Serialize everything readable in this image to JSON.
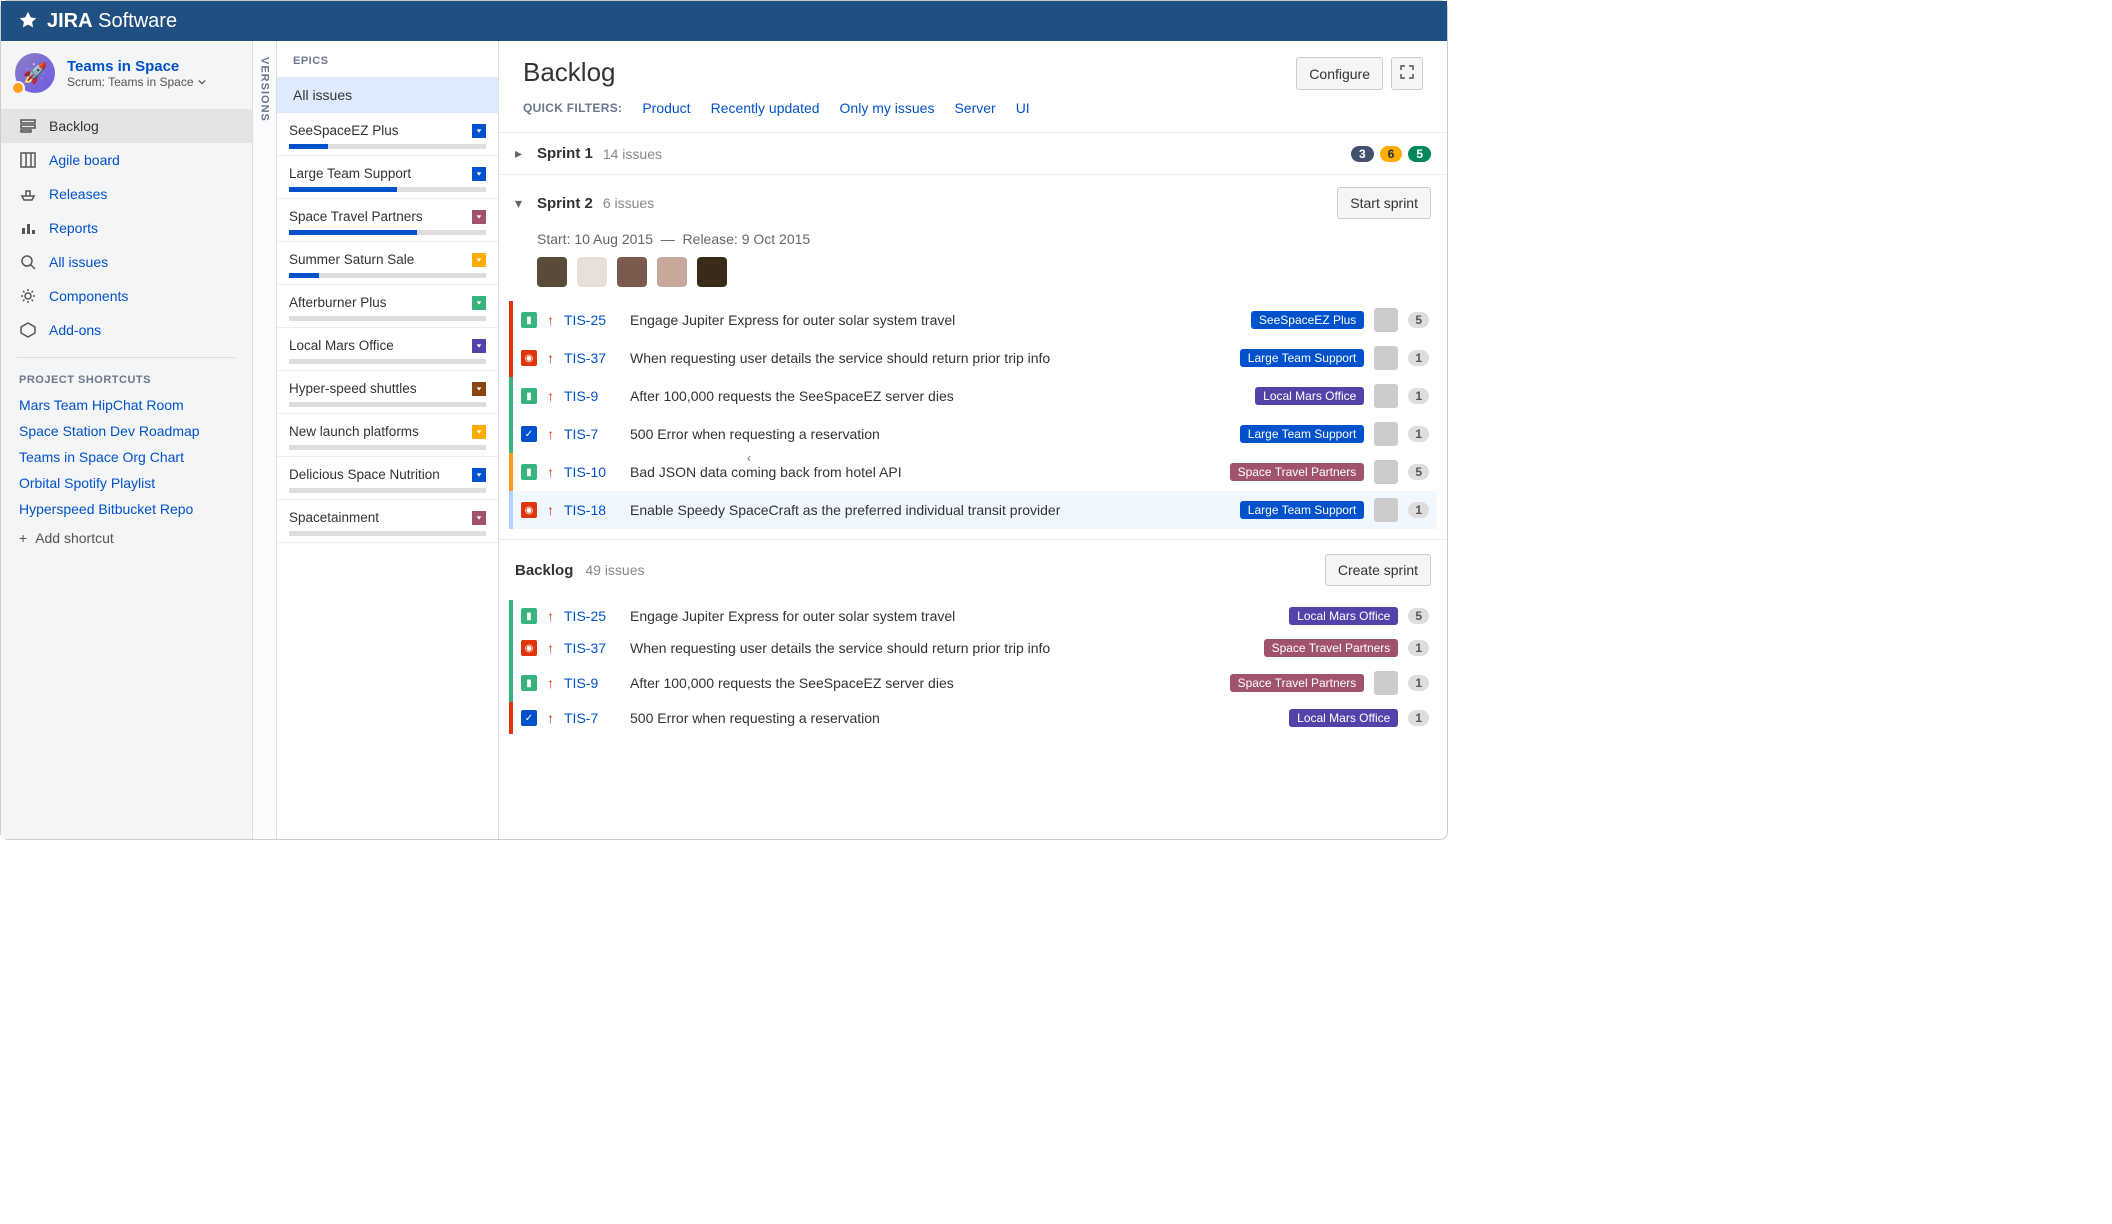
{
  "app_name": "JIRA Software",
  "project": {
    "name": "Teams in Space",
    "subtitle": "Scrum: Teams in Space"
  },
  "nav": [
    {
      "label": "Backlog"
    },
    {
      "label": "Agile board"
    },
    {
      "label": "Releases"
    },
    {
      "label": "Reports"
    },
    {
      "label": "All issues"
    },
    {
      "label": "Components"
    },
    {
      "label": "Add-ons"
    }
  ],
  "shortcuts_heading": "PROJECT SHORTCUTS",
  "shortcuts": [
    "Mars Team HipChat Room",
    "Space Station Dev Roadmap",
    "Teams in Space Org Chart",
    "Orbital Spotify Playlist",
    "Hyperspeed Bitbucket Repo"
  ],
  "add_shortcut": "Add shortcut",
  "versions_label": "VERSIONS",
  "epics_label": "EPICS",
  "epics_all": "All issues",
  "epics": [
    {
      "name": "SeeSpaceEZ Plus",
      "chev": "chev-blue",
      "fill": 20
    },
    {
      "name": "Large Team Support",
      "chev": "chev-blue",
      "fill": 55
    },
    {
      "name": "Space Travel Partners",
      "chev": "chev-maroon",
      "fill": 65
    },
    {
      "name": "Summer Saturn Sale",
      "chev": "chev-amber",
      "fill": 15
    },
    {
      "name": "Afterburner Plus",
      "chev": "chev-green",
      "fill": 0
    },
    {
      "name": "Local Mars Office",
      "chev": "chev-purple",
      "fill": 0
    },
    {
      "name": "Hyper-speed shuttles",
      "chev": "chev-brown",
      "fill": 0
    },
    {
      "name": "New launch platforms",
      "chev": "chev-amber",
      "fill": 0
    },
    {
      "name": "Delicious Space Nutrition",
      "chev": "chev-blue",
      "fill": 0
    },
    {
      "name": "Spacetainment",
      "chev": "chev-maroon",
      "fill": 0
    }
  ],
  "page_title": "Backlog",
  "configure_label": "Configure",
  "quick_filters_label": "QUICK FILTERS:",
  "quick_filters": [
    "Product",
    "Recently updated",
    "Only my issues",
    "Server",
    "UI"
  ],
  "sprint1": {
    "name": "Sprint 1",
    "count": "14 issues",
    "badges": {
      "todo": "3",
      "prog": "6",
      "done": "5"
    }
  },
  "sprint2": {
    "name": "Sprint 2",
    "count": "6 issues",
    "start_label": "Start sprint",
    "meta_start": "Start: 10 Aug 2015",
    "meta_sep": "—",
    "meta_release": "Release: 9 Oct 2015"
  },
  "sprint2_issues": [
    {
      "pri": "pri-red",
      "type": "t-story",
      "arrow": "↑",
      "key": "TIS-25",
      "sum": "Engage Jupiter Express for outer solar system travel",
      "epic": "SeeSpaceEZ Plus",
      "epicc": "et-blue",
      "est": "5"
    },
    {
      "pri": "pri-red",
      "type": "t-bug",
      "arrow": "↑",
      "key": "TIS-37",
      "sum": "When requesting user details the service should return prior trip info",
      "epic": "Large Team Support",
      "epicc": "et-blue",
      "est": "1"
    },
    {
      "pri": "pri-green",
      "type": "t-story",
      "arrow": "↑",
      "key": "TIS-9",
      "sum": "After 100,000 requests the SeeSpaceEZ server dies",
      "epic": "Local Mars Office",
      "epicc": "et-purple",
      "est": "1"
    },
    {
      "pri": "pri-green",
      "type": "t-task",
      "arrow": "↑",
      "key": "TIS-7",
      "sum": "500 Error when requesting a reservation",
      "epic": "Large Team Support",
      "epicc": "et-blue",
      "est": "1"
    },
    {
      "pri": "pri-orange",
      "type": "t-story",
      "arrow": "↑",
      "key": "TIS-10",
      "sum": "Bad JSON data coming back from hotel API",
      "epic": "Space Travel Partners",
      "epicc": "et-maroon",
      "est": "5"
    },
    {
      "pri": "pri-lblue",
      "type": "t-bug",
      "arrow": "↑",
      "key": "TIS-18",
      "sum": "Enable Speedy SpaceCraft as the preferred individual transit provider",
      "epic": "Large Team Support",
      "epicc": "et-blue",
      "est": "1"
    }
  ],
  "backlog": {
    "name": "Backlog",
    "count": "49 issues",
    "create_label": "Create sprint"
  },
  "backlog_issues": [
    {
      "pri": "pri-green",
      "type": "t-story",
      "arrow": "↑",
      "key": "TIS-25",
      "sum": "Engage Jupiter Express for outer solar system travel",
      "epic": "Local Mars Office",
      "epicc": "et-purple",
      "est": "5",
      "noav": true
    },
    {
      "pri": "pri-green",
      "type": "t-bug",
      "arrow": "↑",
      "key": "TIS-37",
      "sum": "When requesting user details the service should return prior trip info",
      "epic": "Space Travel Partners",
      "epicc": "et-maroon",
      "est": "1",
      "noav": true
    },
    {
      "pri": "pri-green",
      "type": "t-story",
      "arrow": "↑",
      "key": "TIS-9",
      "sum": "After 100,000 requests the SeeSpaceEZ server dies",
      "epic": "Space Travel Partners",
      "epicc": "et-maroon",
      "est": "1"
    },
    {
      "pri": "pri-red",
      "type": "t-task",
      "arrow": "↑",
      "key": "TIS-7",
      "sum": "500 Error when requesting a reservation",
      "epic": "Local Mars Office",
      "epicc": "et-purple",
      "est": "1",
      "noav": true
    }
  ]
}
